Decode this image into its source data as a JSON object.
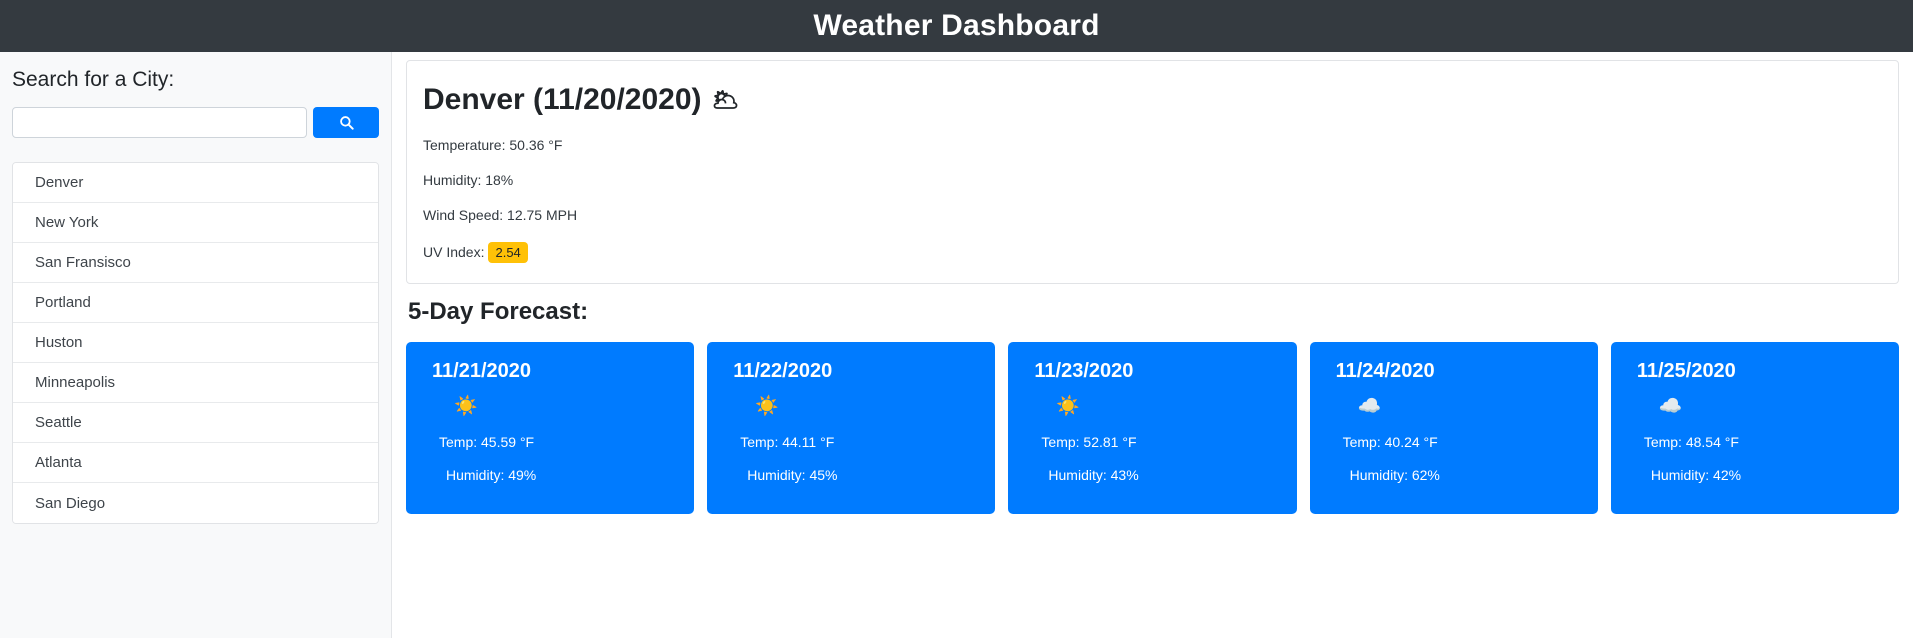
{
  "header": {
    "title": "Weather Dashboard",
    "background_color": "#343a40",
    "text_color": "#ffffff"
  },
  "sidebar": {
    "search_label": "Search for a City:",
    "search_input_value": "",
    "search_input_placeholder": "",
    "search_button_icon": "search-icon",
    "search_button_color": "#007bff",
    "cities": [
      {
        "name": "Denver"
      },
      {
        "name": "New York"
      },
      {
        "name": "San Fransisco"
      },
      {
        "name": "Portland"
      },
      {
        "name": "Huston"
      },
      {
        "name": "Minneapolis"
      },
      {
        "name": "Seattle"
      },
      {
        "name": "Atlanta"
      },
      {
        "name": "San Diego"
      }
    ]
  },
  "current_weather": {
    "heading": "Denver (11/20/2020)",
    "condition_icon": "cloud-sun-icon",
    "condition_glyph": "🌥",
    "temperature": "Temperature: 50.36 °F",
    "humidity": "Humidity: 18%",
    "wind_speed": "Wind Speed: 12.75 MPH",
    "uv_label": "UV Index:",
    "uv_value": "2.54",
    "uv_badge_color": "#ffc107"
  },
  "forecast": {
    "title": "5-Day Forecast:",
    "card_color": "#007bff",
    "days": [
      {
        "date": "11/21/2020",
        "icon_name": "sun-icon",
        "icon_glyph": "☀️",
        "temp": "Temp: 45.59 °F",
        "humidity": "Humidity: 49%"
      },
      {
        "date": "11/22/2020",
        "icon_name": "sun-icon",
        "icon_glyph": "☀️",
        "temp": "Temp: 44.11 °F",
        "humidity": "Humidity: 45%"
      },
      {
        "date": "11/23/2020",
        "icon_name": "sun-icon",
        "icon_glyph": "☀️",
        "temp": "Temp: 52.81 °F",
        "humidity": "Humidity: 43%"
      },
      {
        "date": "11/24/2020",
        "icon_name": "cloud-icon",
        "icon_glyph": "☁️",
        "temp": "Temp: 40.24 °F",
        "humidity": "Humidity: 62%"
      },
      {
        "date": "11/25/2020",
        "icon_name": "cloud-icon",
        "icon_glyph": "☁️",
        "temp": "Temp: 48.54 °F",
        "humidity": "Humidity: 42%"
      }
    ]
  }
}
